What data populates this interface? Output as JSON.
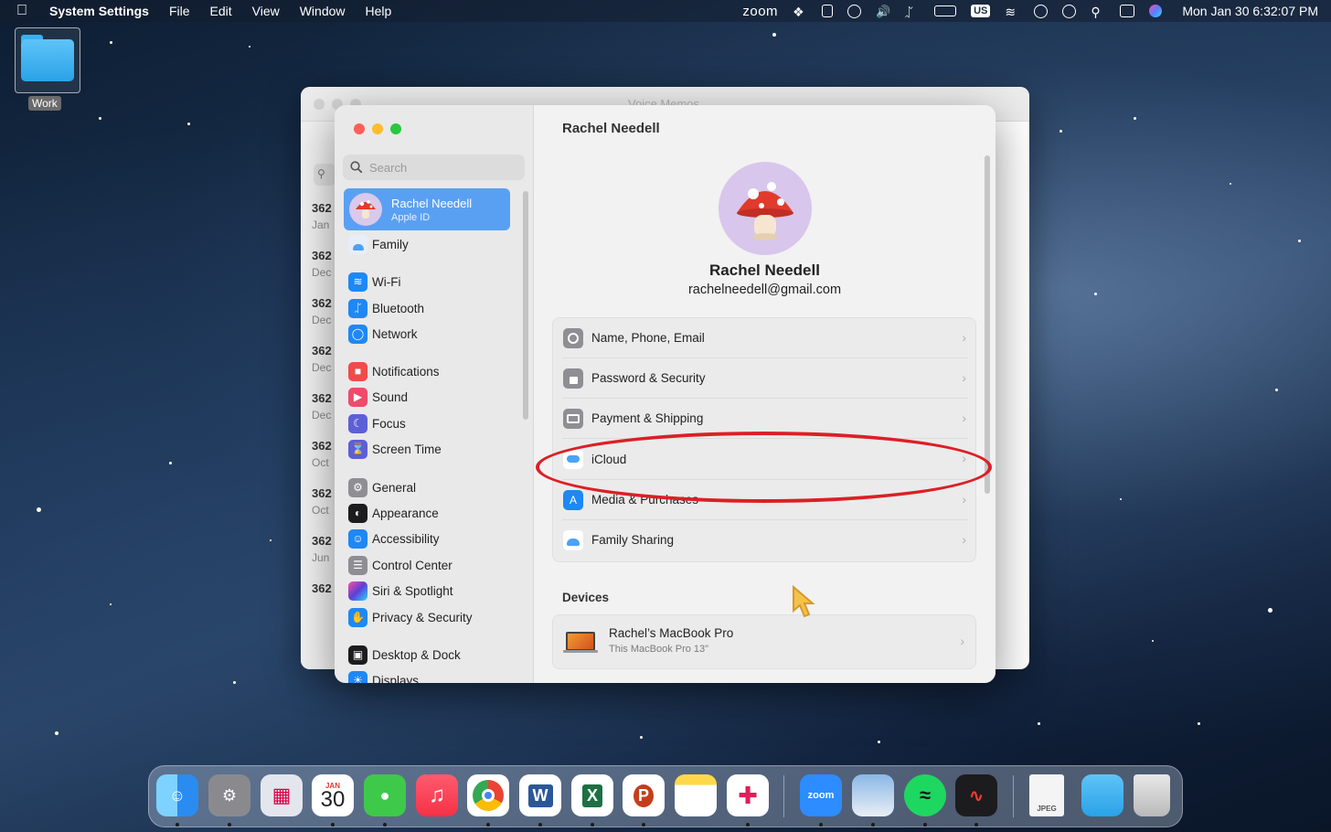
{
  "menubar": {
    "app_name": "System Settings",
    "menus": [
      "File",
      "Edit",
      "View",
      "Window",
      "Help"
    ],
    "zoom_label": "zoom",
    "input_source": "US",
    "datetime": "Mon Jan 30  6:32:07 PM"
  },
  "desktop": {
    "folder_label": "Work"
  },
  "background_window": {
    "title": "Voice Memos",
    "rows": [
      {
        "num": "362",
        "sub": "Jan"
      },
      {
        "num": "362",
        "sub": "Dec"
      },
      {
        "num": "362",
        "sub": "Dec"
      },
      {
        "num": "362",
        "sub": "Dec"
      },
      {
        "num": "362",
        "sub": "Dec"
      },
      {
        "num": "362",
        "sub": "Oct"
      },
      {
        "num": "362",
        "sub": "Oct"
      },
      {
        "num": "362",
        "sub": "Jun"
      },
      {
        "num": "362",
        "sub": ""
      }
    ]
  },
  "settings": {
    "search_placeholder": "Search",
    "profile": {
      "name": "Rachel Needell",
      "sub": "Apple ID"
    },
    "sidebar": [
      {
        "label": "Family",
        "icon": "family-icon",
        "color": "#4a90e2"
      },
      {
        "label": "Wi-Fi",
        "icon": "wifi-icon",
        "color": "#1e88f5"
      },
      {
        "label": "Bluetooth",
        "icon": "bluetooth-icon",
        "color": "#1e88f5"
      },
      {
        "label": "Network",
        "icon": "globe-icon",
        "color": "#1e88f5"
      },
      {
        "label": "Notifications",
        "icon": "bell-icon",
        "color": "#ef4b4b"
      },
      {
        "label": "Sound",
        "icon": "speaker-icon",
        "color": "#ef4b6b"
      },
      {
        "label": "Focus",
        "icon": "moon-icon",
        "color": "#5d5fd6"
      },
      {
        "label": "Screen Time",
        "icon": "hourglass-icon",
        "color": "#5d5fd6"
      },
      {
        "label": "General",
        "icon": "gear-icon",
        "color": "#8e8e93"
      },
      {
        "label": "Appearance",
        "icon": "appearance-icon",
        "color": "#1c1c1e"
      },
      {
        "label": "Accessibility",
        "icon": "accessibility-icon",
        "color": "#1e88f5"
      },
      {
        "label": "Control Center",
        "icon": "control-center-icon",
        "color": "#8e8e93"
      },
      {
        "label": "Siri & Spotlight",
        "icon": "siri-icon",
        "color": "#6b3fd6"
      },
      {
        "label": "Privacy & Security",
        "icon": "hand-icon",
        "color": "#1e88f5"
      },
      {
        "label": "Desktop & Dock",
        "icon": "dock-icon",
        "color": "#1c1c1e"
      },
      {
        "label": "Displays",
        "icon": "display-icon",
        "color": "#1e88f5"
      }
    ],
    "main": {
      "title": "Rachel Needell",
      "user_name": "Rachel Needell",
      "user_email": "rachelneedell@gmail.com",
      "rows": [
        {
          "label": "Name, Phone, Email",
          "icon": "person-icon",
          "color": "#8e8e93"
        },
        {
          "label": "Password & Security",
          "icon": "lock-icon",
          "color": "#8e8e93"
        },
        {
          "label": "Payment & Shipping",
          "icon": "card-icon",
          "color": "#8e8e93"
        },
        {
          "label": "iCloud",
          "icon": "icloud-icon",
          "color": "#4aa3f5"
        },
        {
          "label": "Media & Purchases",
          "icon": "appstore-icon",
          "color": "#1e88f5"
        },
        {
          "label": "Family Sharing",
          "icon": "family-icon",
          "color": "#4aa3f5"
        }
      ],
      "devices_title": "Devices",
      "device": {
        "name": "Rachel’s MacBook Pro",
        "sub": "This MacBook Pro 13\""
      }
    }
  },
  "dock": {
    "apps": [
      {
        "name": "finder-app"
      },
      {
        "name": "system-settings-app"
      },
      {
        "name": "launchpad-app"
      },
      {
        "name": "calendar-app",
        "month": "JAN",
        "day": "30"
      },
      {
        "name": "messages-app"
      },
      {
        "name": "music-app"
      },
      {
        "name": "chrome-app"
      },
      {
        "name": "word-app",
        "letter": "W"
      },
      {
        "name": "excel-app",
        "letter": "X"
      },
      {
        "name": "powerpoint-app",
        "letter": "P"
      },
      {
        "name": "notes-app"
      },
      {
        "name": "slack-app"
      },
      {
        "name": "zoom-app",
        "label": "zoom"
      },
      {
        "name": "preview-app"
      },
      {
        "name": "spotify-app"
      },
      {
        "name": "voice-memos-app"
      },
      {
        "name": "jpeg-file",
        "label": "JPEG"
      },
      {
        "name": "folder-app"
      },
      {
        "name": "trash-app"
      }
    ]
  },
  "highlight_color": "#dc1f26"
}
